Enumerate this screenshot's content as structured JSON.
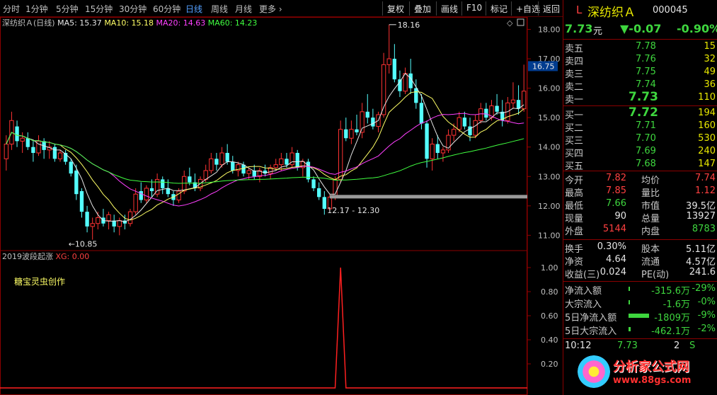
{
  "toolbar": {
    "periods": [
      "分时",
      "1分钟",
      "5分钟",
      "15分钟",
      "30分钟",
      "60分钟",
      "日线",
      "周线",
      "月线",
      "更多 ›"
    ],
    "active_period": "日线",
    "buttons": [
      "复权",
      "叠加",
      "画线",
      "F10",
      "标记",
      "+自选",
      "返回"
    ]
  },
  "main_chart": {
    "title": "深纺织Ａ(日线)",
    "ma_legend": [
      {
        "label": "MA5: 15.37",
        "color": "#e6e6e6"
      },
      {
        "label": "MA10: 15.18",
        "color": "#ffff66"
      },
      {
        "label": "MA20: 14.63",
        "color": "#ff40ff"
      },
      {
        "label": "MA60: 14.23",
        "color": "#40ff40"
      }
    ],
    "y_ticks": [
      "18.00",
      "17.00",
      "16.00",
      "15.00",
      "14.00",
      "13.00",
      "12.00",
      "11.00"
    ],
    "current_price_tag": "16.75",
    "annotations": {
      "high": "18.16",
      "low": "10.85",
      "range": "12.17 - 12.30"
    }
  },
  "indicator": {
    "title": "2019波段起涨",
    "xg_label": "XG: 0.00",
    "author_note": "糖宝灵虫创作",
    "y_ticks": [
      "1.00",
      "0.80",
      "0.60",
      "0.40",
      "0.20"
    ]
  },
  "chart_data": {
    "type": "candlestick",
    "ylim": [
      10.6,
      18.3
    ],
    "candles": [
      [
        13.6,
        14.4,
        13.2,
        14.1
      ],
      [
        14.1,
        15.2,
        13.9,
        14.9
      ],
      [
        14.7,
        14.9,
        14.0,
        14.2
      ],
      [
        14.2,
        14.5,
        13.8,
        14.3
      ],
      [
        14.3,
        14.5,
        13.9,
        14.0
      ],
      [
        14.0,
        14.2,
        13.5,
        13.8
      ],
      [
        13.8,
        14.4,
        13.7,
        14.2
      ],
      [
        14.2,
        14.3,
        13.6,
        13.9
      ],
      [
        13.9,
        14.2,
        13.6,
        14.0
      ],
      [
        14.0,
        14.1,
        13.5,
        13.6
      ],
      [
        13.6,
        13.9,
        13.5,
        13.8
      ],
      [
        13.8,
        13.9,
        13.4,
        13.5
      ],
      [
        13.5,
        13.6,
        13.0,
        13.1
      ],
      [
        13.2,
        13.4,
        12.2,
        12.4
      ],
      [
        12.5,
        12.6,
        11.6,
        11.8
      ],
      [
        11.8,
        12.0,
        11.1,
        11.3
      ],
      [
        11.3,
        11.6,
        10.85,
        11.4
      ],
      [
        11.4,
        11.8,
        11.2,
        11.6
      ],
      [
        11.6,
        11.9,
        11.3,
        11.4
      ],
      [
        11.5,
        11.8,
        11.2,
        11.7
      ],
      [
        11.5,
        11.7,
        11.1,
        11.3
      ],
      [
        11.3,
        11.6,
        11.0,
        11.5
      ],
      [
        11.5,
        11.7,
        11.2,
        11.4
      ],
      [
        11.4,
        11.9,
        11.3,
        11.8
      ],
      [
        11.8,
        12.6,
        11.7,
        12.4
      ],
      [
        12.5,
        12.8,
        12.1,
        12.2
      ],
      [
        12.2,
        12.7,
        12.1,
        12.6
      ],
      [
        12.6,
        12.9,
        12.3,
        12.5
      ],
      [
        12.4,
        13.1,
        12.3,
        12.9
      ],
      [
        12.9,
        13.0,
        12.4,
        12.6
      ],
      [
        12.6,
        12.9,
        12.3,
        12.4
      ],
      [
        12.4,
        12.5,
        12.0,
        12.2
      ],
      [
        12.2,
        12.6,
        12.1,
        12.5
      ],
      [
        12.5,
        13.2,
        12.4,
        13.0
      ],
      [
        13.0,
        13.3,
        12.7,
        12.8
      ],
      [
        12.8,
        13.1,
        12.5,
        12.6
      ],
      [
        12.6,
        13.0,
        12.5,
        12.9
      ],
      [
        12.9,
        13.4,
        12.8,
        13.2
      ],
      [
        13.2,
        13.8,
        13.1,
        13.6
      ],
      [
        13.6,
        13.8,
        13.2,
        13.4
      ],
      [
        13.4,
        14.0,
        13.3,
        13.8
      ],
      [
        13.8,
        14.1,
        13.4,
        13.5
      ],
      [
        13.5,
        13.7,
        13.1,
        13.2
      ],
      [
        13.2,
        13.5,
        13.0,
        13.4
      ],
      [
        13.4,
        13.5,
        13.0,
        13.1
      ],
      [
        13.1,
        13.3,
        12.9,
        13.2
      ],
      [
        13.2,
        13.4,
        12.9,
        13.0
      ],
      [
        13.0,
        13.3,
        12.8,
        13.2
      ],
      [
        13.2,
        13.4,
        13.0,
        13.1
      ],
      [
        13.1,
        13.4,
        12.9,
        13.3
      ],
      [
        13.3,
        13.6,
        13.2,
        13.4
      ],
      [
        13.4,
        13.8,
        13.2,
        13.6
      ],
      [
        13.6,
        13.8,
        13.3,
        13.4
      ],
      [
        13.4,
        14.0,
        13.3,
        13.8
      ],
      [
        13.8,
        13.9,
        13.2,
        13.3
      ],
      [
        13.3,
        13.6,
        13.0,
        13.5
      ],
      [
        13.5,
        13.6,
        12.8,
        12.9
      ],
      [
        12.9,
        13.0,
        12.5,
        12.6
      ],
      [
        12.6,
        12.8,
        12.2,
        12.3
      ],
      [
        12.3,
        12.5,
        11.7,
        11.9
      ],
      [
        11.9,
        12.4,
        11.8,
        12.3
      ],
      [
        12.3,
        13.0,
        12.2,
        12.9
      ],
      [
        12.9,
        14.9,
        12.8,
        14.6
      ],
      [
        14.6,
        15.0,
        14.2,
        14.3
      ],
      [
        14.3,
        14.9,
        14.1,
        14.6
      ],
      [
        14.6,
        15.1,
        14.4,
        14.5
      ],
      [
        14.5,
        15.5,
        14.3,
        15.2
      ],
      [
        15.2,
        15.8,
        14.8,
        15.0
      ],
      [
        15.0,
        15.3,
        14.6,
        14.7
      ],
      [
        14.7,
        15.2,
        14.5,
        15.1
      ],
      [
        15.1,
        17.2,
        15.0,
        16.8
      ],
      [
        16.8,
        18.16,
        16.5,
        17.0
      ],
      [
        17.0,
        17.5,
        16.2,
        16.3
      ],
      [
        16.3,
        16.6,
        15.7,
        15.9
      ],
      [
        15.9,
        16.7,
        15.8,
        16.5
      ],
      [
        16.5,
        17.0,
        15.8,
        16.0
      ],
      [
        16.0,
        16.3,
        15.3,
        15.5
      ],
      [
        15.5,
        15.8,
        14.6,
        14.8
      ],
      [
        14.8,
        14.9,
        13.3,
        13.6
      ],
      [
        13.6,
        14.3,
        13.2,
        14.1
      ],
      [
        14.1,
        14.4,
        13.6,
        13.8
      ],
      [
        13.8,
        14.0,
        13.5,
        13.9
      ],
      [
        13.9,
        14.6,
        13.8,
        14.4
      ],
      [
        14.4,
        14.8,
        14.2,
        14.6
      ],
      [
        14.6,
        15.2,
        14.5,
        15.0
      ],
      [
        15.0,
        15.2,
        14.6,
        14.7
      ],
      [
        14.7,
        15.0,
        14.2,
        14.4
      ],
      [
        14.4,
        15.1,
        14.3,
        14.9
      ],
      [
        14.9,
        15.5,
        14.8,
        15.3
      ],
      [
        15.3,
        15.5,
        14.9,
        15.0
      ],
      [
        15.0,
        15.6,
        14.9,
        15.4
      ],
      [
        15.4,
        15.8,
        15.1,
        15.2
      ],
      [
        15.2,
        15.6,
        14.7,
        14.9
      ],
      [
        14.9,
        15.7,
        14.8,
        15.5
      ],
      [
        15.5,
        16.2,
        15.3,
        15.6
      ],
      [
        15.6,
        16.1,
        15.1,
        15.3
      ],
      [
        15.3,
        16.8,
        15.2,
        15.9
      ]
    ],
    "signal_peak_index": 62,
    "signal_value": 1.0
  },
  "quote": {
    "prefix": "L",
    "name": "深纺织Ａ",
    "code": "000045",
    "price": "7.73",
    "price_unit": "元",
    "change": "▼-0.07",
    "change_pct": "-0.90%",
    "asks": [
      {
        "label": "卖五",
        "price": "7.78",
        "vol": "15"
      },
      {
        "label": "卖四",
        "price": "7.76",
        "vol": "32"
      },
      {
        "label": "卖三",
        "price": "7.75",
        "vol": "49"
      },
      {
        "label": "卖二",
        "price": "7.74",
        "vol": "36"
      },
      {
        "label": "卖一",
        "price": "7.73",
        "vol": "110"
      }
    ],
    "bids": [
      {
        "label": "买一",
        "price": "7.72",
        "vol": "194"
      },
      {
        "label": "买二",
        "price": "7.71",
        "vol": "160"
      },
      {
        "label": "买三",
        "price": "7.70",
        "vol": "530"
      },
      {
        "label": "买四",
        "price": "7.69",
        "vol": "240"
      },
      {
        "label": "买五",
        "price": "7.68",
        "vol": "147"
      }
    ],
    "stats": [
      {
        "l1": "今开",
        "v1": "7.82",
        "c1": "red",
        "l2": "均价",
        "v2": "7.74",
        "c2": "red"
      },
      {
        "l1": "最高",
        "v1": "7.85",
        "c1": "red",
        "l2": "量比",
        "v2": "1.12",
        "c2": "red"
      },
      {
        "l1": "最低",
        "v1": "7.66",
        "c1": "green",
        "l2": "市值",
        "v2": "39.5亿",
        "c2": "white"
      },
      {
        "l1": "现量",
        "v1": "90",
        "c1": "white",
        "l2": "总量",
        "v2": "13927",
        "c2": "white"
      },
      {
        "l1": "外盘",
        "v1": "5144",
        "c1": "red",
        "l2": "内盘",
        "v2": "8783",
        "c2": "green"
      }
    ],
    "fundamentals": [
      {
        "l1": "换手",
        "v1": "0.30%",
        "l2": "股本",
        "v2": "5.11亿"
      },
      {
        "l1": "净资",
        "v1": "4.64",
        "l2": "流通",
        "v2": "4.57亿"
      },
      {
        "l1": "收益(三)",
        "v1": "0.024",
        "l2": "PE(动)",
        "v2": "241.6"
      }
    ],
    "flows": [
      {
        "label": "净流入额",
        "value": "-315.6万",
        "pct": "-29%",
        "bar": 0.02
      },
      {
        "label": "大宗流入",
        "value": "-1.6万",
        "pct": "-0%",
        "bar": 0.01
      },
      {
        "label": "5日净流入额",
        "value": "-1809万",
        "pct": "-9%",
        "bar": 0.95
      },
      {
        "label": "5日大宗流入",
        "value": "-462.1万",
        "pct": "-2%",
        "bar": 0.1
      }
    ],
    "ticks": [
      {
        "time": "10:12",
        "price": "7.73",
        "vol": "2",
        "side": "S"
      }
    ]
  },
  "watermark": {
    "text": "分析家公式网",
    "url": "www.88gs.com"
  }
}
